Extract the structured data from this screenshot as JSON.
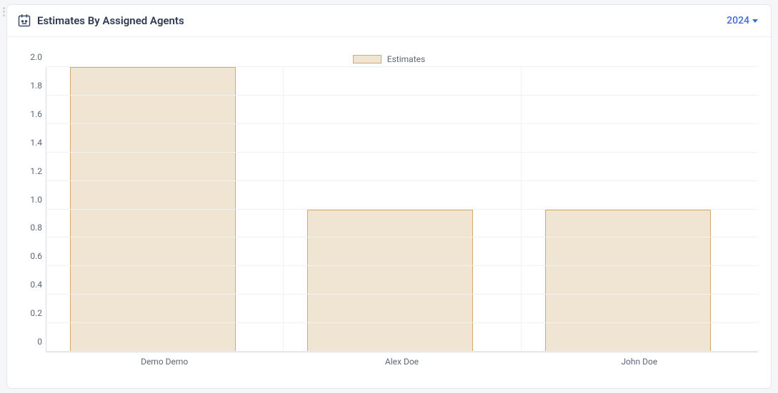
{
  "header": {
    "title": "Estimates By Assigned Agents",
    "year": "2024"
  },
  "legend": {
    "label": "Estimates"
  },
  "chart_data": {
    "type": "bar",
    "categories": [
      "Demo Demo",
      "Alex Doe",
      "John Doe"
    ],
    "values": [
      2.0,
      1.0,
      1.0
    ],
    "series_name": "Estimates",
    "title": "Estimates By Assigned Agents",
    "xlabel": "",
    "ylabel": "",
    "ylim": [
      0,
      2.0
    ],
    "yticks": [
      0,
      0.2,
      0.4,
      0.6,
      0.8,
      1.0,
      1.2,
      1.4,
      1.6,
      1.8,
      2.0
    ]
  }
}
